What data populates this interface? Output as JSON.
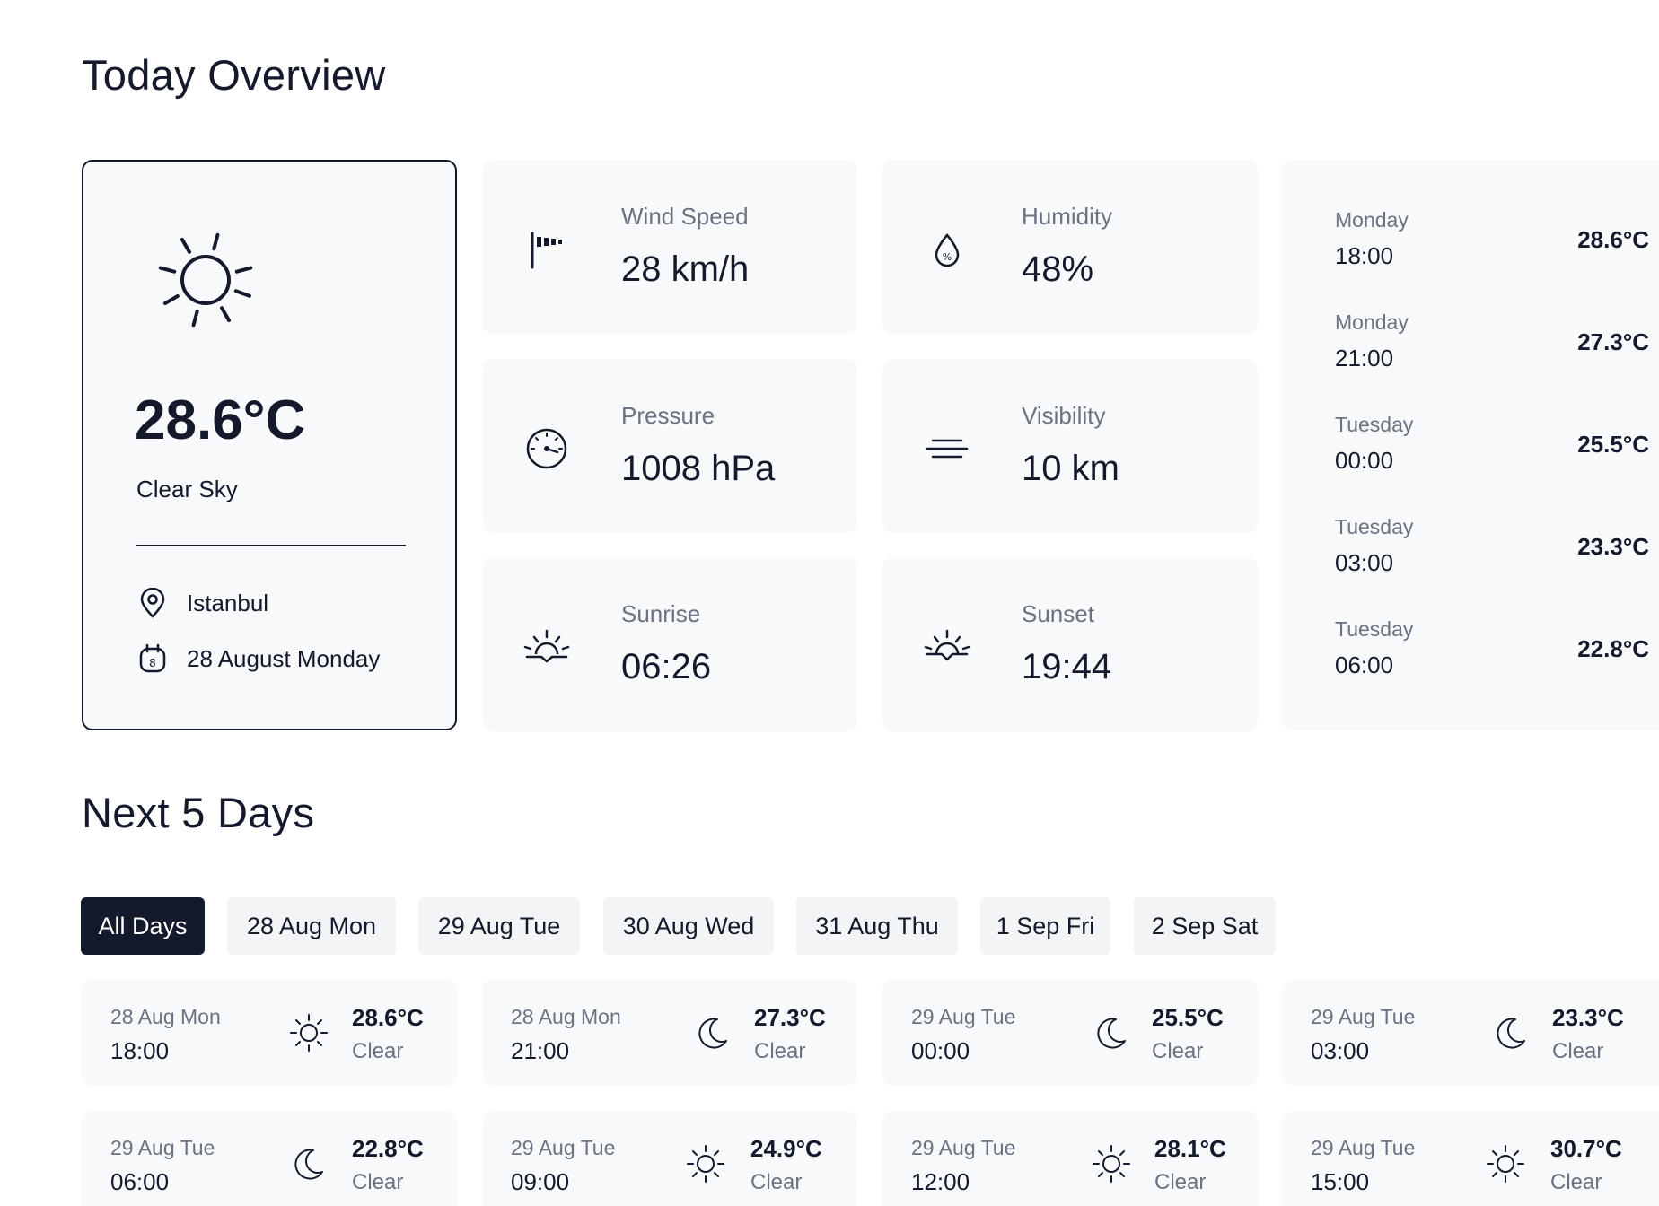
{
  "today": {
    "title": "Today Overview",
    "current": {
      "icon": "sun-icon",
      "temperature": "28.6°C",
      "condition": "Clear Sky",
      "location": "Istanbul",
      "date": "28 August Monday"
    },
    "stats": {
      "wind": {
        "label": "Wind Speed",
        "value": "28 km/h",
        "icon": "windsock-icon"
      },
      "humidity": {
        "label": "Humidity",
        "value": "48%",
        "icon": "humidity-drop-icon"
      },
      "pressure": {
        "label": "Pressure",
        "value": "1008 hPa",
        "icon": "gauge-icon"
      },
      "visibility": {
        "label": "Visibility",
        "value": "10 km",
        "icon": "fog-lines-icon"
      },
      "sunrise": {
        "label": "Sunrise",
        "value": "06:26",
        "icon": "sunrise-icon"
      },
      "sunset": {
        "label": "Sunset",
        "value": "19:44",
        "icon": "sunset-icon"
      }
    },
    "hourly": [
      {
        "day": "Monday",
        "time": "18:00",
        "temp": "28.6°C"
      },
      {
        "day": "Monday",
        "time": "21:00",
        "temp": "27.3°C"
      },
      {
        "day": "Tuesday",
        "time": "00:00",
        "temp": "25.5°C"
      },
      {
        "day": "Tuesday",
        "time": "03:00",
        "temp": "23.3°C"
      },
      {
        "day": "Tuesday",
        "time": "06:00",
        "temp": "22.8°C"
      }
    ]
  },
  "next": {
    "title": "Next 5 Days",
    "tabs": [
      {
        "label": "All Days",
        "active": true
      },
      {
        "label": "28 Aug Mon"
      },
      {
        "label": "29 Aug Tue"
      },
      {
        "label": "30 Aug Wed"
      },
      {
        "label": "31 Aug Thu"
      },
      {
        "label": "1 Sep Fri"
      },
      {
        "label": "2 Sep Sat"
      }
    ],
    "forecast": [
      {
        "date": "28 Aug Mon",
        "time": "18:00",
        "temp": "28.6°C",
        "cond": "Clear",
        "icon": "sun-icon"
      },
      {
        "date": "28 Aug Mon",
        "time": "21:00",
        "temp": "27.3°C",
        "cond": "Clear",
        "icon": "moon-icon"
      },
      {
        "date": "29 Aug Tue",
        "time": "00:00",
        "temp": "25.5°C",
        "cond": "Clear",
        "icon": "moon-icon"
      },
      {
        "date": "29 Aug Tue",
        "time": "03:00",
        "temp": "23.3°C",
        "cond": "Clear",
        "icon": "moon-icon"
      },
      {
        "date": "29 Aug Tue",
        "time": "06:00",
        "temp": "22.8°C",
        "cond": "Clear",
        "icon": "moon-icon"
      },
      {
        "date": "29 Aug Tue",
        "time": "09:00",
        "temp": "24.9°C",
        "cond": "Clear",
        "icon": "sun-icon"
      },
      {
        "date": "29 Aug Tue",
        "time": "12:00",
        "temp": "28.1°C",
        "cond": "Clear",
        "icon": "sun-icon"
      },
      {
        "date": "29 Aug Tue",
        "time": "15:00",
        "temp": "30.7°C",
        "cond": "Clear",
        "icon": "sun-icon"
      }
    ]
  }
}
